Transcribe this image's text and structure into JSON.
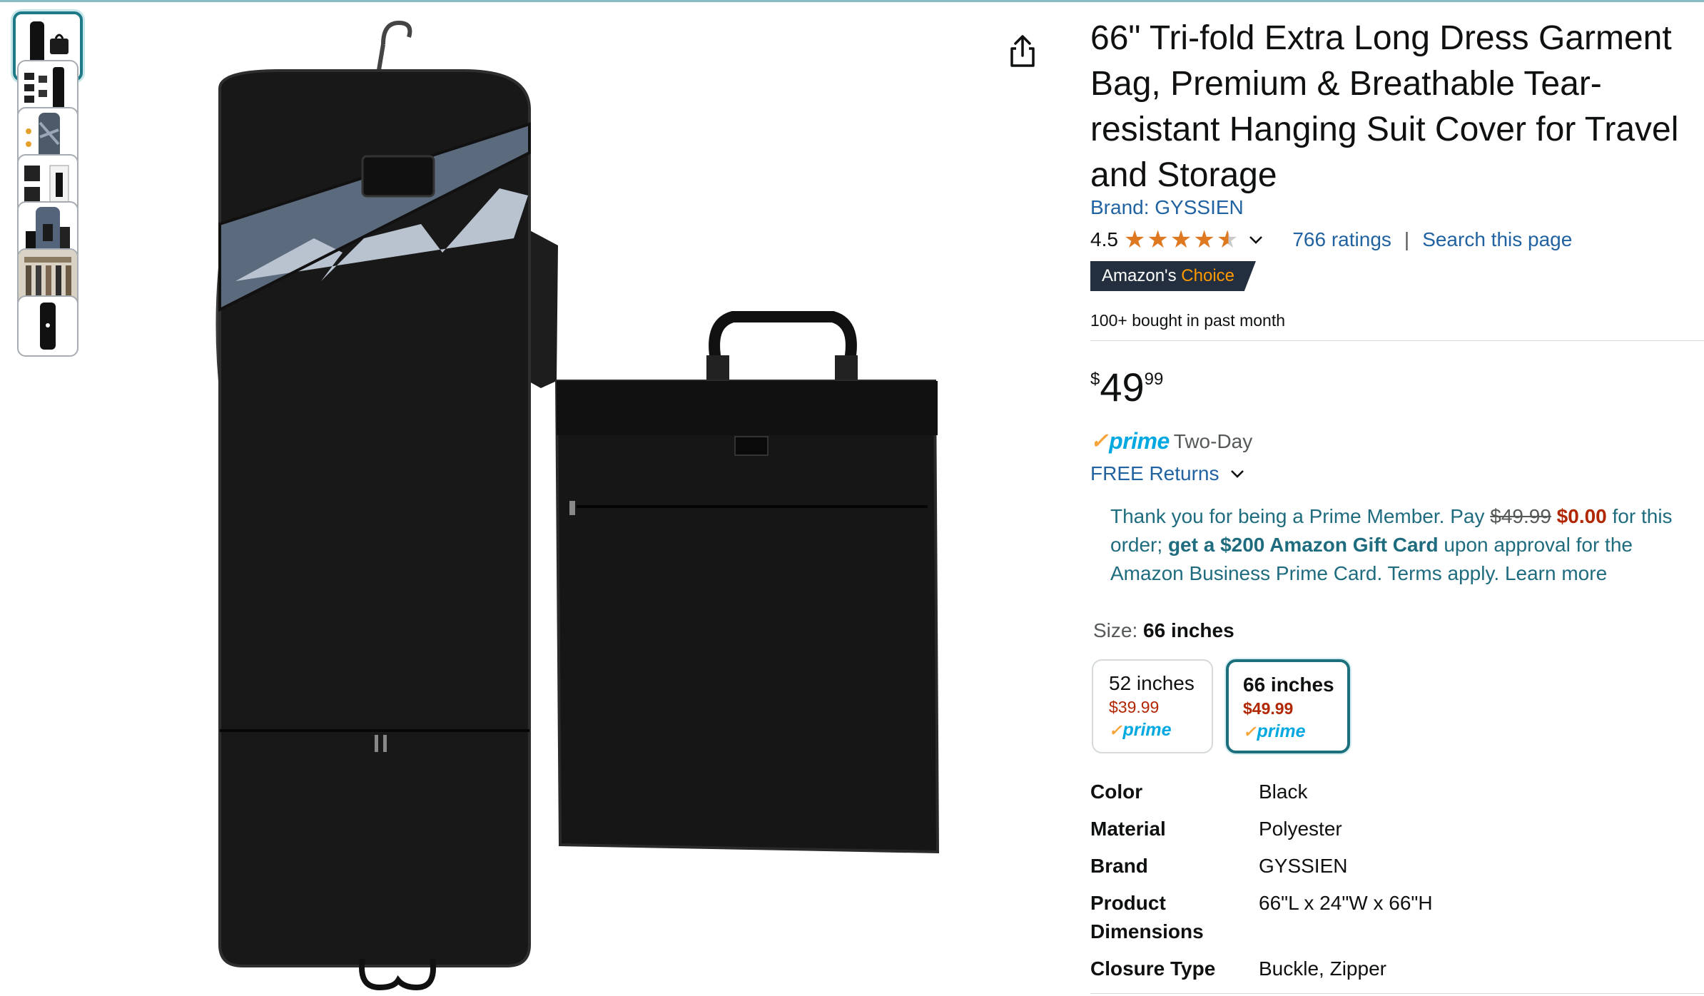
{
  "product": {
    "title": "66\" Tri-fold Extra Long Dress Garment Bag, Premium & Breathable Tear-resistant Hanging Suit Cover for Travel and Storage",
    "brand_link": "Brand: GYSSIEN",
    "rating_value": "4.5",
    "rating_stars": 4.5,
    "ratings_count": "766 ratings",
    "search_page": "Search this page",
    "choice_prefix": "Amazon's",
    "choice_word": "Choice",
    "bought": "100+ bought in past month",
    "price": {
      "symbol": "$",
      "whole": "49",
      "fraction": "99"
    },
    "prime_logo": "prime",
    "delivery": "Two-Day",
    "returns": "FREE Returns",
    "promo": {
      "p1": "Thank you for being a Prime Member. Pay ",
      "strike": "$49.99",
      "sp1": " ",
      "free": "$0.00",
      "p2": " for this order; ",
      "bold": "get a $200 Amazon Gift Card",
      "p3": " upon approval for the Amazon Business Prime Card. Terms apply. ",
      "learn": "Learn more"
    },
    "size_label": "Size:",
    "size_selected": "66 inches",
    "sizes": [
      {
        "name": "52 inches",
        "price": "$39.99",
        "prime": "prime"
      },
      {
        "name": "66 inches",
        "price": "$49.99",
        "prime": "prime"
      }
    ],
    "specs": [
      {
        "key": "Color",
        "value": "Black"
      },
      {
        "key": "Material",
        "value": "Polyester"
      },
      {
        "key": "Brand",
        "value": "GYSSIEN"
      },
      {
        "key": "Product Dimensions",
        "value": "66\"L x 24\"W x 66\"H"
      },
      {
        "key": "Closure Type",
        "value": "Buckle, Zipper"
      }
    ]
  },
  "colors": {
    "link": "#2162a1",
    "price_red": "#b12704",
    "prime_blue": "#00a8e1",
    "star": "#de7921",
    "badge": "#232f3e",
    "selected_border": "#1e6f7d"
  },
  "icons": [
    "share-icon",
    "chevron-down-icon",
    "star-icon",
    "check-icon"
  ]
}
